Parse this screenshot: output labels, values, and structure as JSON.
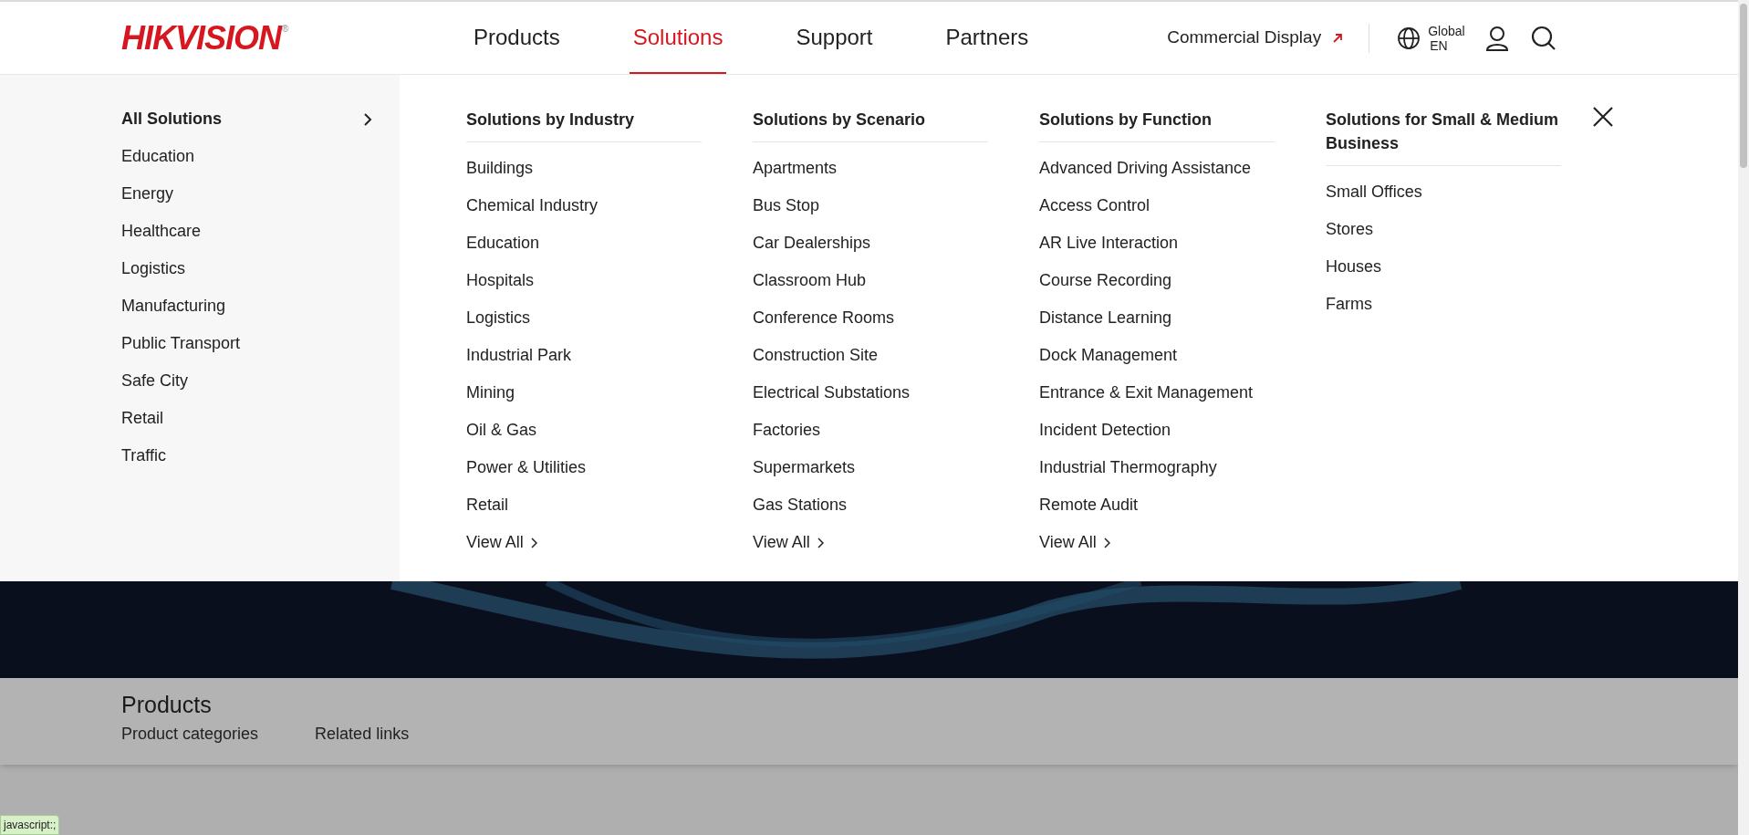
{
  "header": {
    "logo": "HIKVISION",
    "logo_mark": "®",
    "nav": [
      {
        "label": "Products",
        "selected": false
      },
      {
        "label": "Solutions",
        "selected": true
      },
      {
        "label": "Support",
        "selected": false
      },
      {
        "label": "Partners",
        "selected": false
      }
    ],
    "commercial_display": "Commercial Display",
    "region": "Global",
    "language": "EN"
  },
  "sidebar": {
    "title": "All Solutions",
    "items": [
      "Education",
      "Energy",
      "Healthcare",
      "Logistics",
      "Manufacturing",
      "Public Transport",
      "Safe City",
      "Retail",
      "Traffic"
    ]
  },
  "columns": [
    {
      "title": "Solutions by Industry",
      "items": [
        "Buildings",
        "Chemical Industry",
        "Education",
        "Hospitals",
        "Logistics",
        "Industrial Park",
        "Mining",
        "Oil & Gas",
        "Power & Utilities",
        "Retail"
      ],
      "view_all": "View All"
    },
    {
      "title": "Solutions by Scenario",
      "items": [
        "Apartments",
        "Bus Stop",
        "Car Dealerships",
        "Classroom Hub",
        "Conference Rooms",
        "Construction Site",
        "Electrical Substations",
        "Factories",
        "Supermarkets",
        "Gas Stations"
      ],
      "view_all": "View All"
    },
    {
      "title": "Solutions by Function",
      "items": [
        "Advanced Driving Assistance",
        "Access Control",
        "AR Live Interaction",
        "Course Recording",
        "Distance Learning",
        "Dock Management",
        "Entrance & Exit Management",
        "Incident Detection",
        "Industrial Thermography",
        "Remote Audit"
      ],
      "view_all": "View All"
    },
    {
      "title": "Solutions for Small & Medium Business",
      "items": [
        "Small Offices",
        "Stores",
        "Houses",
        "Farms"
      ]
    }
  ],
  "section": {
    "title": "Products",
    "tabs": [
      "Product categories",
      "Related links"
    ]
  },
  "status_bar": "javascript:;"
}
